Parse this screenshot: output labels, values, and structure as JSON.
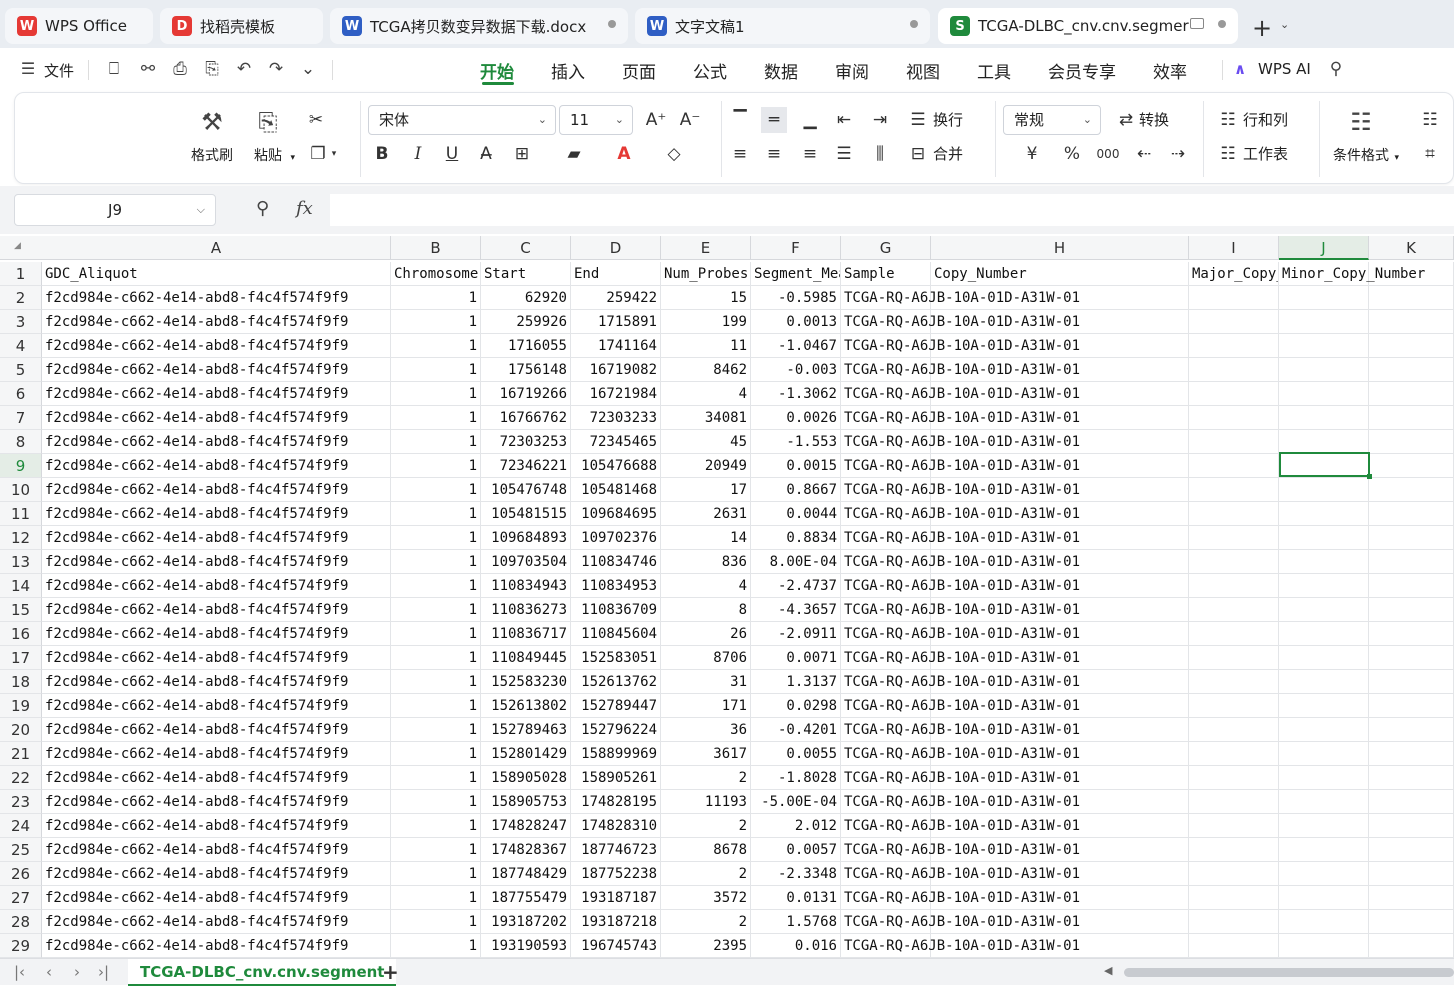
{
  "tabs": [
    {
      "label": "WPS Office",
      "icon": "wps-logo",
      "color": "#e53935",
      "glyph": "W"
    },
    {
      "label": "找稻壳模板",
      "icon": "docer-logo",
      "color": "#e53935",
      "glyph": "D"
    },
    {
      "label": "TCGA拷贝数变异数据下载.docx",
      "icon": "word-doc-icon",
      "color": "#2f5ec4",
      "glyph": "W"
    },
    {
      "label": "文字文稿1",
      "icon": "word-doc-icon",
      "color": "#2f5ec4",
      "glyph": "W"
    },
    {
      "label": "TCGA-DLBC_cnv.cnv.segmer",
      "icon": "sheet-icon",
      "color": "#1f8a3c",
      "glyph": "S"
    }
  ],
  "menu": {
    "file": "文件",
    "items": [
      "开始",
      "插入",
      "页面",
      "公式",
      "数据",
      "审阅",
      "视图",
      "工具",
      "会员专享",
      "效率"
    ],
    "active": "开始",
    "wps_ai": "WPS AI"
  },
  "ribbon": {
    "format_painter": "格式刷",
    "paste": "粘贴",
    "font_name": "宋体",
    "font_size": "11",
    "wrap": "换行",
    "merge": "合并",
    "number_format": "常规",
    "convert": "转换",
    "rows_cols": "行和列",
    "worksheet": "工作表",
    "cond_format": "条件格式"
  },
  "formula": {
    "name_box": "J9",
    "fx": "fx",
    "value": ""
  },
  "columns": [
    "A",
    "B",
    "C",
    "D",
    "E",
    "F",
    "G",
    "H",
    "I",
    "J",
    "K"
  ],
  "selected_cell": {
    "col": "J",
    "row": 9
  },
  "rows": [
    [
      "GDC_Aliquot",
      "Chromosome",
      "Start",
      "End",
      "Num_Probes",
      "Segment_Mean",
      "Sample",
      "Copy_Number",
      "Major_Copy_Number",
      "Minor_Copy_Number",
      ""
    ],
    [
      "f2cd984e-c662-4e14-abd8-f4c4f574f9f9",
      "1",
      "62920",
      "259422",
      "15",
      "-0.5985",
      "TCGA-RQ-A6JB-10A-01D-A31W-01",
      "",
      "",
      "",
      ""
    ],
    [
      "f2cd984e-c662-4e14-abd8-f4c4f574f9f9",
      "1",
      "259926",
      "1715891",
      "199",
      "0.0013",
      "TCGA-RQ-A6JB-10A-01D-A31W-01",
      "",
      "",
      "",
      ""
    ],
    [
      "f2cd984e-c662-4e14-abd8-f4c4f574f9f9",
      "1",
      "1716055",
      "1741164",
      "11",
      "-1.0467",
      "TCGA-RQ-A6JB-10A-01D-A31W-01",
      "",
      "",
      "",
      ""
    ],
    [
      "f2cd984e-c662-4e14-abd8-f4c4f574f9f9",
      "1",
      "1756148",
      "16719082",
      "8462",
      "-0.003",
      "TCGA-RQ-A6JB-10A-01D-A31W-01",
      "",
      "",
      "",
      ""
    ],
    [
      "f2cd984e-c662-4e14-abd8-f4c4f574f9f9",
      "1",
      "16719266",
      "16721984",
      "4",
      "-1.3062",
      "TCGA-RQ-A6JB-10A-01D-A31W-01",
      "",
      "",
      "",
      ""
    ],
    [
      "f2cd984e-c662-4e14-abd8-f4c4f574f9f9",
      "1",
      "16766762",
      "72303233",
      "34081",
      "0.0026",
      "TCGA-RQ-A6JB-10A-01D-A31W-01",
      "",
      "",
      "",
      ""
    ],
    [
      "f2cd984e-c662-4e14-abd8-f4c4f574f9f9",
      "1",
      "72303253",
      "72345465",
      "45",
      "-1.553",
      "TCGA-RQ-A6JB-10A-01D-A31W-01",
      "",
      "",
      "",
      ""
    ],
    [
      "f2cd984e-c662-4e14-abd8-f4c4f574f9f9",
      "1",
      "72346221",
      "105476688",
      "20949",
      "0.0015",
      "TCGA-RQ-A6JB-10A-01D-A31W-01",
      "",
      "",
      "",
      ""
    ],
    [
      "f2cd984e-c662-4e14-abd8-f4c4f574f9f9",
      "1",
      "105476748",
      "105481468",
      "17",
      "0.8667",
      "TCGA-RQ-A6JB-10A-01D-A31W-01",
      "",
      "",
      "",
      ""
    ],
    [
      "f2cd984e-c662-4e14-abd8-f4c4f574f9f9",
      "1",
      "105481515",
      "109684695",
      "2631",
      "0.0044",
      "TCGA-RQ-A6JB-10A-01D-A31W-01",
      "",
      "",
      "",
      ""
    ],
    [
      "f2cd984e-c662-4e14-abd8-f4c4f574f9f9",
      "1",
      "109684893",
      "109702376",
      "14",
      "0.8834",
      "TCGA-RQ-A6JB-10A-01D-A31W-01",
      "",
      "",
      "",
      ""
    ],
    [
      "f2cd984e-c662-4e14-abd8-f4c4f574f9f9",
      "1",
      "109703504",
      "110834746",
      "836",
      "8.00E-04",
      "TCGA-RQ-A6JB-10A-01D-A31W-01",
      "",
      "",
      "",
      ""
    ],
    [
      "f2cd984e-c662-4e14-abd8-f4c4f574f9f9",
      "1",
      "110834943",
      "110834953",
      "4",
      "-2.4737",
      "TCGA-RQ-A6JB-10A-01D-A31W-01",
      "",
      "",
      "",
      ""
    ],
    [
      "f2cd984e-c662-4e14-abd8-f4c4f574f9f9",
      "1",
      "110836273",
      "110836709",
      "8",
      "-4.3657",
      "TCGA-RQ-A6JB-10A-01D-A31W-01",
      "",
      "",
      "",
      ""
    ],
    [
      "f2cd984e-c662-4e14-abd8-f4c4f574f9f9",
      "1",
      "110836717",
      "110845604",
      "26",
      "-2.0911",
      "TCGA-RQ-A6JB-10A-01D-A31W-01",
      "",
      "",
      "",
      ""
    ],
    [
      "f2cd984e-c662-4e14-abd8-f4c4f574f9f9",
      "1",
      "110849445",
      "152583051",
      "8706",
      "0.0071",
      "TCGA-RQ-A6JB-10A-01D-A31W-01",
      "",
      "",
      "",
      ""
    ],
    [
      "f2cd984e-c662-4e14-abd8-f4c4f574f9f9",
      "1",
      "152583230",
      "152613762",
      "31",
      "1.3137",
      "TCGA-RQ-A6JB-10A-01D-A31W-01",
      "",
      "",
      "",
      ""
    ],
    [
      "f2cd984e-c662-4e14-abd8-f4c4f574f9f9",
      "1",
      "152613802",
      "152789447",
      "171",
      "0.0298",
      "TCGA-RQ-A6JB-10A-01D-A31W-01",
      "",
      "",
      "",
      ""
    ],
    [
      "f2cd984e-c662-4e14-abd8-f4c4f574f9f9",
      "1",
      "152789463",
      "152796224",
      "36",
      "-0.4201",
      "TCGA-RQ-A6JB-10A-01D-A31W-01",
      "",
      "",
      "",
      ""
    ],
    [
      "f2cd984e-c662-4e14-abd8-f4c4f574f9f9",
      "1",
      "152801429",
      "158899969",
      "3617",
      "0.0055",
      "TCGA-RQ-A6JB-10A-01D-A31W-01",
      "",
      "",
      "",
      ""
    ],
    [
      "f2cd984e-c662-4e14-abd8-f4c4f574f9f9",
      "1",
      "158905028",
      "158905261",
      "2",
      "-1.8028",
      "TCGA-RQ-A6JB-10A-01D-A31W-01",
      "",
      "",
      "",
      ""
    ],
    [
      "f2cd984e-c662-4e14-abd8-f4c4f574f9f9",
      "1",
      "158905753",
      "174828195",
      "11193",
      "-5.00E-04",
      "TCGA-RQ-A6JB-10A-01D-A31W-01",
      "",
      "",
      "",
      ""
    ],
    [
      "f2cd984e-c662-4e14-abd8-f4c4f574f9f9",
      "1",
      "174828247",
      "174828310",
      "2",
      "2.012",
      "TCGA-RQ-A6JB-10A-01D-A31W-01",
      "",
      "",
      "",
      ""
    ],
    [
      "f2cd984e-c662-4e14-abd8-f4c4f574f9f9",
      "1",
      "174828367",
      "187746723",
      "8678",
      "0.0057",
      "TCGA-RQ-A6JB-10A-01D-A31W-01",
      "",
      "",
      "",
      ""
    ],
    [
      "f2cd984e-c662-4e14-abd8-f4c4f574f9f9",
      "1",
      "187748429",
      "187752238",
      "2",
      "-2.3348",
      "TCGA-RQ-A6JB-10A-01D-A31W-01",
      "",
      "",
      "",
      ""
    ],
    [
      "f2cd984e-c662-4e14-abd8-f4c4f574f9f9",
      "1",
      "187755479",
      "193187187",
      "3572",
      "0.0131",
      "TCGA-RQ-A6JB-10A-01D-A31W-01",
      "",
      "",
      "",
      ""
    ],
    [
      "f2cd984e-c662-4e14-abd8-f4c4f574f9f9",
      "1",
      "193187202",
      "193187218",
      "2",
      "1.5768",
      "TCGA-RQ-A6JB-10A-01D-A31W-01",
      "",
      "",
      "",
      ""
    ],
    [
      "f2cd984e-c662-4e14-abd8-f4c4f574f9f9",
      "1",
      "193190593",
      "196745743",
      "2395",
      "0.016",
      "TCGA-RQ-A6JB-10A-01D-A31W-01",
      "",
      "",
      "",
      ""
    ]
  ],
  "sheet": {
    "name": "TCGA-DLBC_cnv.cnv.segment",
    "add": "+"
  },
  "colors": {
    "accent": "#1f8a3c",
    "wps_red": "#e53935",
    "word_blue": "#2f5ec4"
  }
}
